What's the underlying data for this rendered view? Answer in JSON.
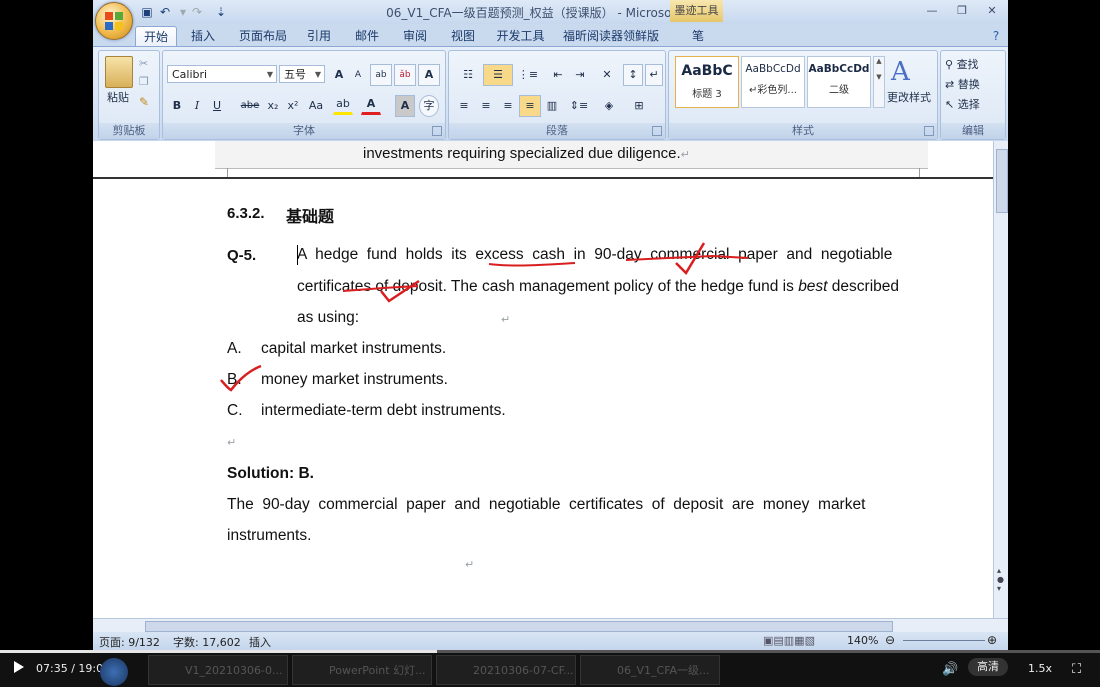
{
  "window": {
    "title": "06_V1_CFA一级百题预测_权益（授课版） - Microsoft Word",
    "contextual_tab": "墨迹工具",
    "controls": [
      "—",
      "❐",
      "✕"
    ]
  },
  "tabs": [
    "开始",
    "插入",
    "页面布局",
    "引用",
    "邮件",
    "审阅",
    "视图",
    "开发工具",
    "福昕阅读器领鲜版",
    "笔"
  ],
  "ribbon": {
    "clipboard": {
      "paste": "粘贴",
      "label": "剪贴板"
    },
    "font": {
      "name": "Calibri",
      "size": "五号",
      "label": "字体",
      "grow": "A",
      "shrink": "A",
      "bold": "B",
      "italic": "I",
      "underline": "U",
      "strike": "abe",
      "sub": "x₂",
      "sup": "x²",
      "case": "Aa",
      "color_a": "A"
    },
    "paragraph": {
      "label": "段落"
    },
    "styles": {
      "label": "样式",
      "items": [
        {
          "sample": "AaBbC",
          "name": "标题 3"
        },
        {
          "sample": "AaBbCcDd",
          "name": "↵彩色列..."
        },
        {
          "sample": "AaBbCcDd",
          "name": "二级"
        }
      ],
      "change": "更改样式"
    },
    "editing": {
      "label": "编辑",
      "find": "查找",
      "replace": "替换",
      "select": "选择"
    }
  },
  "document": {
    "prev_page_line": "investments requiring specialized due diligence.",
    "section_number": "6.3.2.",
    "section_title": "基础题",
    "question_label": "Q-5.",
    "question_line1": "A  hedge  fund  holds  its  excess  cash  in  90-day  commercial  paper  and  negotiable",
    "question_line2_a": "certificates of deposit. The cash management policy of the hedge fund is ",
    "question_line2_em": "best",
    "question_line2_b": " described",
    "question_line3": "as using:",
    "options": [
      {
        "letter": "A.",
        "text": "capital market instruments."
      },
      {
        "letter": "B.",
        "text": "money market instruments."
      },
      {
        "letter": "C.",
        "text": "intermediate-term debt instruments."
      }
    ],
    "solution_label": "Solution: B.",
    "solution_line1": "The  90-day  commercial  paper  and  negotiable  certificates  of  deposit  are  money  market",
    "solution_line2": "instruments."
  },
  "statusbar": {
    "page": "页面: 9/132",
    "words": "字数: 17,602",
    "mode": "插入",
    "zoom": "140%"
  },
  "player": {
    "time": "07:35 / 19:05",
    "progress": 0.397,
    "quality": "高清",
    "speed": "1.5x",
    "taskbar": [
      "V1_20210306-0...",
      "PowerPoint 幻灯...",
      "20210306-07-CF...",
      "06_V1_CFA一级..."
    ]
  }
}
